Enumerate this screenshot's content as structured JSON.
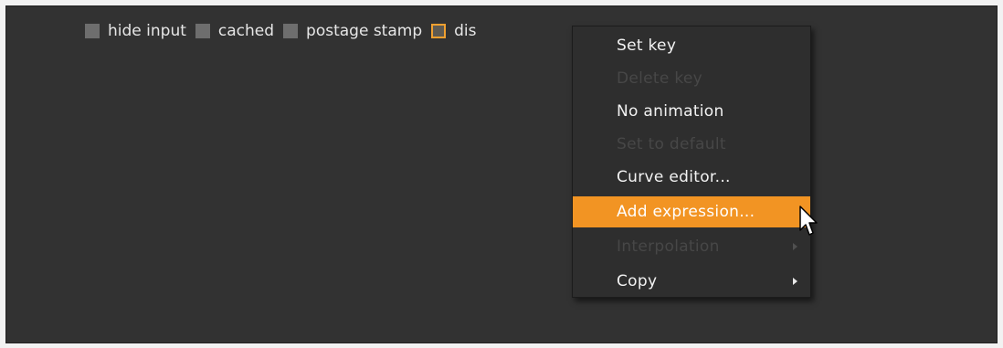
{
  "checkboxes": [
    {
      "label": "hide input",
      "checked": false
    },
    {
      "label": "cached",
      "checked": false
    },
    {
      "label": "postage stamp",
      "checked": false
    },
    {
      "label": "dis",
      "checked": false,
      "focused": true
    }
  ],
  "context_menu": {
    "items": [
      {
        "label": "Set key",
        "enabled": true
      },
      {
        "label": "Delete key",
        "enabled": false
      },
      {
        "label": "No animation",
        "enabled": true
      },
      {
        "label": "Set to default",
        "enabled": false
      },
      {
        "label": "Curve editor...",
        "enabled": true
      },
      {
        "label": "Add expression...",
        "enabled": true,
        "highlighted": true
      },
      {
        "label": "Interpolation",
        "enabled": false,
        "submenu": true
      },
      {
        "label": "Copy",
        "enabled": true,
        "submenu": true
      }
    ]
  },
  "colors": {
    "panel_bg": "#323232",
    "menu_bg": "#2e2e2e",
    "highlight": "#f29423",
    "checkbox_accent": "#f0a030"
  },
  "icons": {
    "cursor": "mouse-pointer-icon",
    "submenu": "submenu-arrow-icon"
  }
}
